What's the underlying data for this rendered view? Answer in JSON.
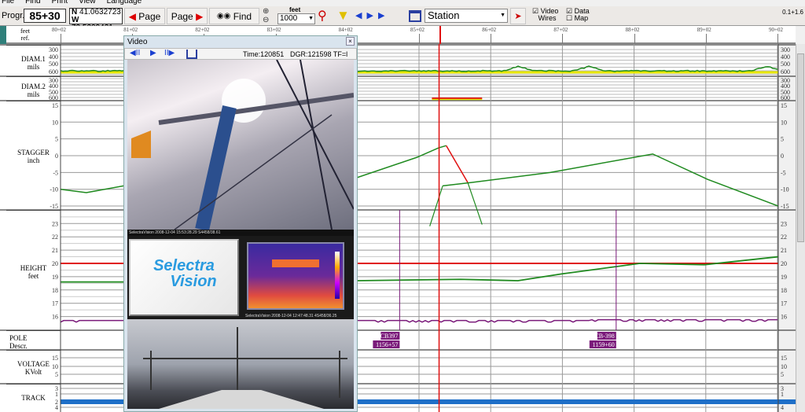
{
  "menu": [
    "File",
    "Find",
    "Print",
    "View",
    "Language"
  ],
  "toolbar": {
    "progr_label": "Progr.",
    "progr_value": "85+30",
    "lat_prefix": "N",
    "lat": "41.0632723",
    "lon_prefix": "W",
    "lon": "73.5209421",
    "page_prev": "Page",
    "page_next": "Page",
    "find": "Find",
    "unit_label": "feet",
    "zoom_value": "1000",
    "station_select": "Station",
    "video_wires_1": "Video",
    "video_wires_2": "Wires",
    "data_map_1": "Data",
    "data_map_2": "Map",
    "video_checked": true,
    "data_checked": true,
    "version": "0.1+1.6"
  },
  "ruler": {
    "unit": "feet",
    "ref": "ref.",
    "stations": [
      "80+02",
      "81+02",
      "82+02",
      "83+02",
      "84+02",
      "85+02",
      "86+02",
      "87+02",
      "88+02",
      "89+02",
      "90+02"
    ]
  },
  "panels": {
    "diam1": {
      "name": "DIAM.1",
      "unit": "mils",
      "ticks": [
        "300",
        "400",
        "500",
        "600"
      ]
    },
    "diam2": {
      "name": "DIAM.2",
      "unit": "mils",
      "ticks": [
        "300",
        "400",
        "500",
        "600"
      ]
    },
    "stagger": {
      "name": "STAGGER",
      "unit": "inch",
      "ticks": [
        "15",
        "10",
        "5",
        "0",
        "-5",
        "-10",
        "-15"
      ]
    },
    "height": {
      "name": "HEIGHT",
      "unit": "feet",
      "ticks": [
        "23",
        "22",
        "21",
        "20",
        "19",
        "18",
        "17",
        "16"
      ]
    },
    "pole": {
      "name": "POLE",
      "unit": "Descr."
    },
    "voltage": {
      "name": "VOLTAGE",
      "unit": "KVolt",
      "ticks": [
        "15",
        "10",
        "5"
      ]
    },
    "track": {
      "name": "TRACK",
      "ticks": [
        "3",
        "1",
        "2",
        "4"
      ]
    }
  },
  "cursor_station_ft": 8530,
  "poles": [
    {
      "id": "CB397",
      "station": "1156+57",
      "ft": 8475
    },
    {
      "id": "CB-398",
      "station": "1159+60",
      "ft": 8777
    }
  ],
  "series": {
    "stagger": [
      [
        8002,
        -10
      ],
      [
        8038,
        -11
      ],
      [
        8090,
        -9
      ],
      [
        8416,
        -6.5
      ],
      [
        8499,
        -0.5
      ],
      [
        8529,
        2.3
      ],
      [
        8540,
        3
      ],
      [
        8570,
        -8
      ],
      [
        8575,
        -8
      ],
      [
        8685,
        -5
      ],
      [
        8828,
        0.5
      ],
      [
        8904,
        -7
      ],
      [
        9003,
        -15
      ]
    ],
    "height_green": [
      [
        8002,
        18.6
      ],
      [
        8090,
        18.6
      ],
      [
        8416,
        18.7
      ],
      [
        8560,
        18.8
      ],
      [
        8640,
        18.7
      ],
      [
        8700,
        19.2
      ],
      [
        8810,
        20
      ],
      [
        8900,
        19.9
      ],
      [
        9003,
        20.5
      ]
    ],
    "height_limit": 20,
    "height_purple": 15.7,
    "diam1_green": 590,
    "diam1_limit": 600
  },
  "colors": {
    "green": "#1f8a1f",
    "red": "#e01010",
    "purple": "#7a1a7a",
    "yellow": "#e6e600",
    "track": "#1e6fc8",
    "cursor": "#e01010"
  },
  "video": {
    "title": "Video",
    "time": "Time:120851",
    "dgr": "DGR:121598 TF=l",
    "caption1": "SelectraVision 2008-12-04 15:53:28.29 S4458/38.61",
    "caption2": "SelectraVision 2008-12-04 12:47:48.31 4S458/36.25",
    "logo_1": "Selectra",
    "logo_2": "Vision"
  }
}
